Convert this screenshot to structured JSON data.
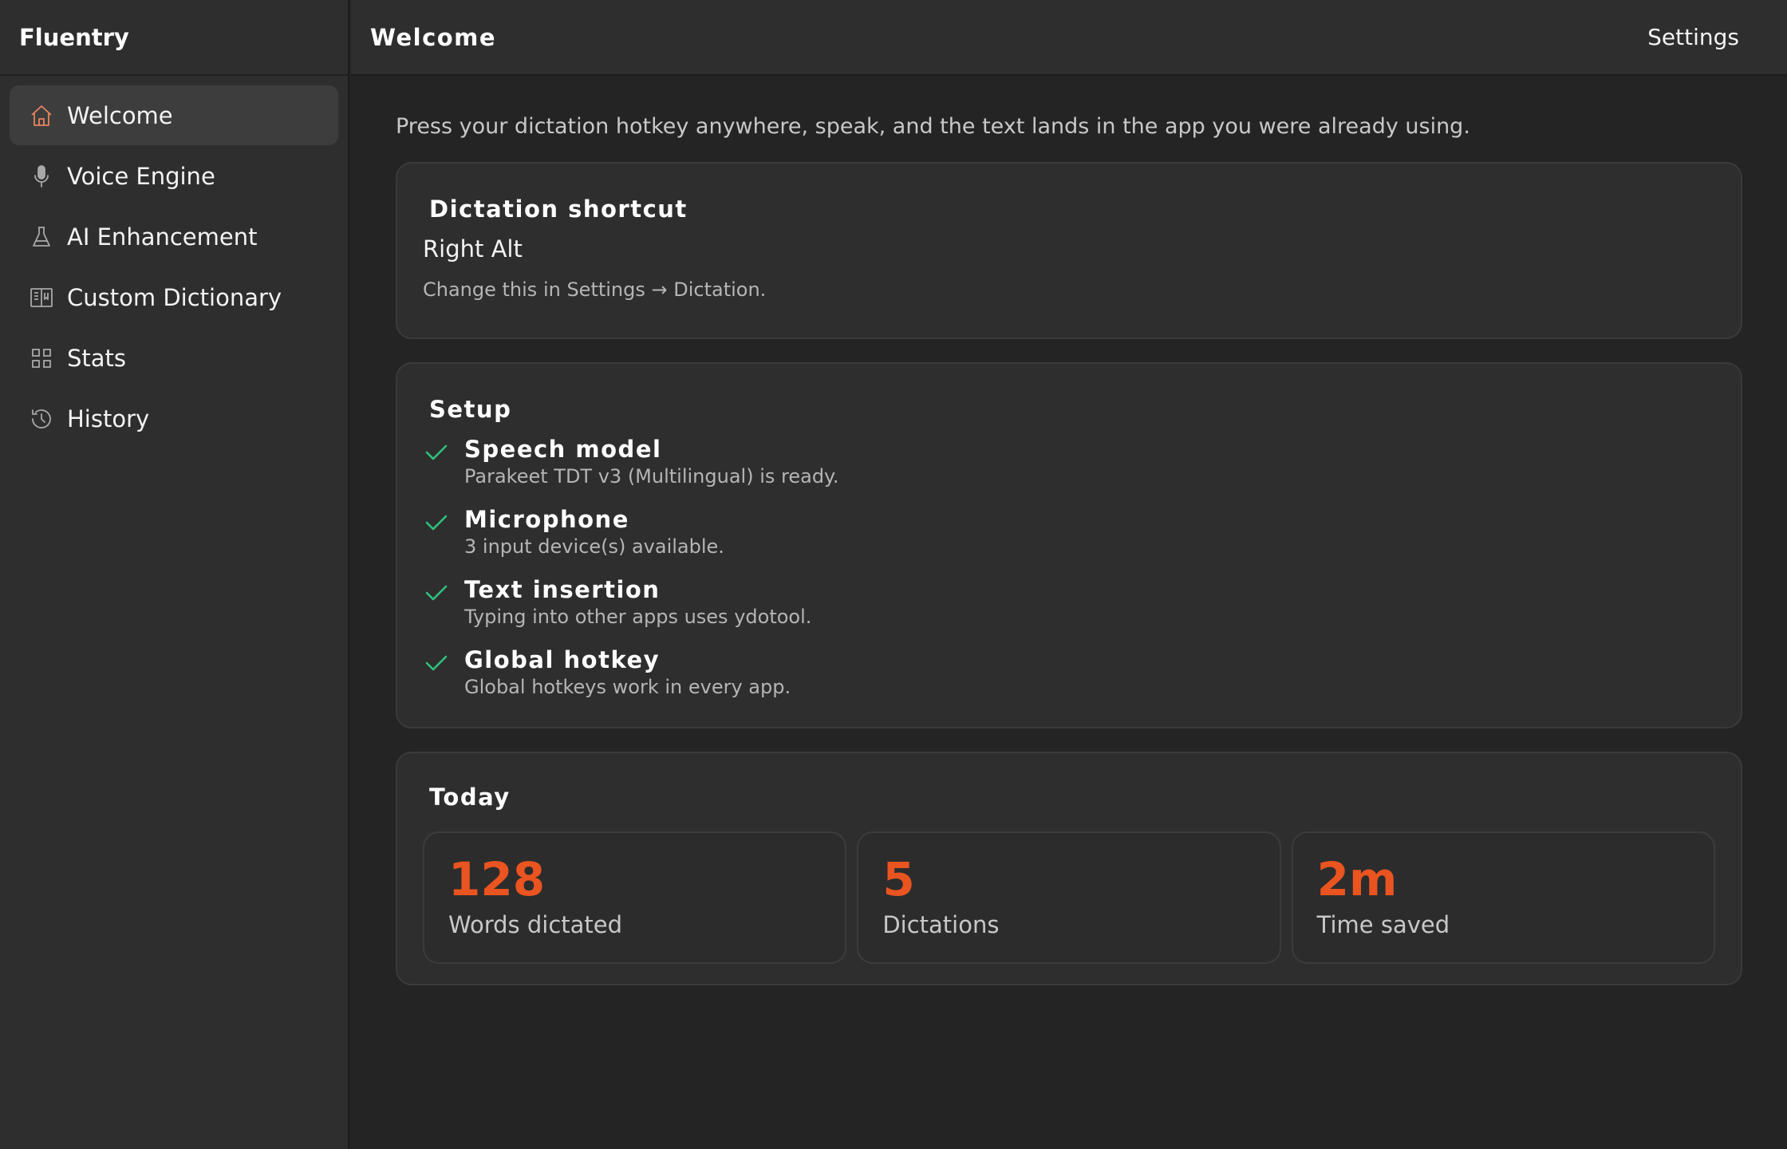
{
  "app": {
    "title": "Fluentry"
  },
  "header": {
    "title": "Welcome",
    "settings_label": "Settings"
  },
  "sidebar": {
    "items": [
      {
        "label": "Welcome",
        "icon": "home-icon",
        "active": true
      },
      {
        "label": "Voice Engine",
        "icon": "microphone-icon"
      },
      {
        "label": "AI Enhancement",
        "icon": "flask-icon"
      },
      {
        "label": "Custom Dictionary",
        "icon": "book-icon"
      },
      {
        "label": "Stats",
        "icon": "grid-icon"
      },
      {
        "label": "History",
        "icon": "history-icon"
      }
    ]
  },
  "main": {
    "intro": "Press your dictation hotkey anywhere, speak, and the text lands in the app you were already using.",
    "shortcut": {
      "title": "Dictation shortcut",
      "value": "Right Alt",
      "hint": "Change this in Settings → Dictation."
    },
    "setup": {
      "title": "Setup",
      "items": [
        {
          "label": "Speech model",
          "desc": "Parakeet TDT v3 (Multilingual) is ready.",
          "status": "ok"
        },
        {
          "label": "Microphone",
          "desc": "3 input device(s) available.",
          "status": "ok"
        },
        {
          "label": "Text insertion",
          "desc": "Typing into other apps uses ydotool.",
          "status": "ok"
        },
        {
          "label": "Global hotkey",
          "desc": "Global hotkeys work in every app.",
          "status": "ok"
        }
      ]
    },
    "today": {
      "title": "Today",
      "stats": [
        {
          "value": "128",
          "label": "Words dictated"
        },
        {
          "value": "5",
          "label": "Dictations"
        },
        {
          "value": "2m",
          "label": "Time saved"
        }
      ]
    }
  },
  "colors": {
    "accent": "#e95420",
    "check": "#2ec27e",
    "background": "#242424",
    "panel": "#2e2e2e"
  }
}
